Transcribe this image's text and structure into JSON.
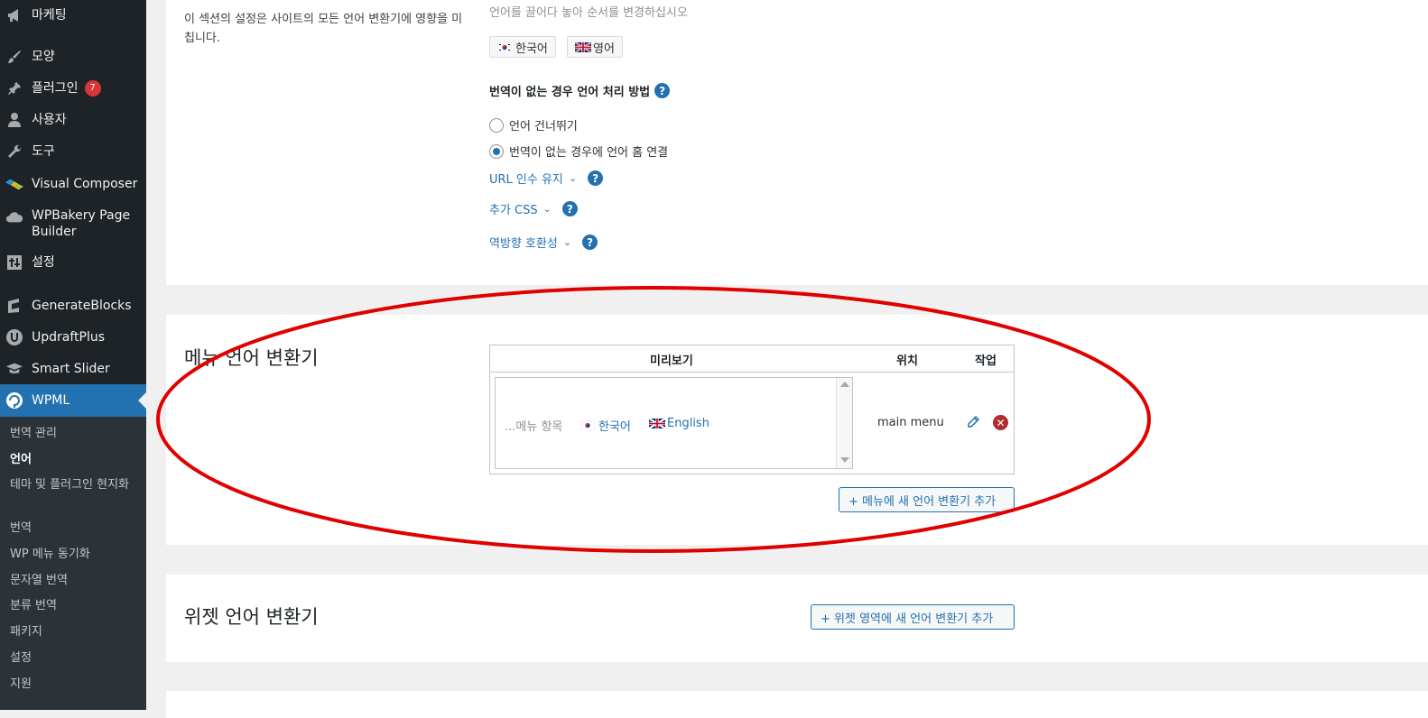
{
  "sidebar": {
    "items": [
      {
        "label": "마케팅",
        "icon": "megaphone-icon"
      },
      {
        "label": "모양",
        "icon": "paintbrush-icon"
      },
      {
        "label": "플러그인",
        "icon": "plugin-icon",
        "badge": "7"
      },
      {
        "label": "사용자",
        "icon": "user-icon"
      },
      {
        "label": "도구",
        "icon": "wrench-icon"
      },
      {
        "label": "Visual Composer",
        "icon": "visual-composer-icon"
      },
      {
        "label": "WPBakery Page Builder",
        "icon": "cloud-icon"
      },
      {
        "label": "설정",
        "icon": "settings-sliders-icon"
      },
      {
        "label": "GenerateBlocks",
        "icon": "generateblocks-icon"
      },
      {
        "label": "UpdraftPlus",
        "icon": "updraftplus-icon"
      },
      {
        "label": "Smart Slider",
        "icon": "graduation-cap-icon"
      },
      {
        "label": "WPML",
        "icon": "wpml-icon"
      }
    ],
    "submenu": [
      {
        "label": "번역 관리"
      },
      {
        "label": "언어",
        "current": true
      },
      {
        "label": "테마 및 플러그인 현지화"
      },
      {
        "label": "번역"
      },
      {
        "label": "WP 메뉴 동기화"
      },
      {
        "label": "문자열 번역"
      },
      {
        "label": "분류 번역"
      },
      {
        "label": "패키지"
      },
      {
        "label": "설정"
      },
      {
        "label": "지원"
      }
    ]
  },
  "options_panel": {
    "description": "이 섹션의 설정은 사이트의 모든 언어 변환기에 영향을 미칩니다.",
    "order_hint": "언어를 끌어다 놓아 순서를 변경하십시오",
    "languages": [
      {
        "label": "한국어",
        "flag": "kr-flag"
      },
      {
        "label": "영어",
        "flag": "gb-flag"
      }
    ],
    "missing_translation_label": "번역이 없는 경우 언어 처리 방법",
    "radio_options": [
      {
        "label": "언어 건너뛰기",
        "checked": false
      },
      {
        "label": "번역이 없는 경우에 언어 홈 연결",
        "checked": true
      }
    ],
    "toggles": [
      "URL 인수 유지",
      "추가 CSS",
      "역방향 호환성"
    ]
  },
  "menu_switcher": {
    "title": "메뉴 언어 변환기",
    "col_preview": "미리보기",
    "col_location": "위치",
    "col_action": "작업",
    "preview_prefix": "...메뉴 항목",
    "preview_lang1": "한국어",
    "preview_lang2": "English",
    "location": "main menu",
    "add_button": "+ 메뉴에 새 언어 변환기 추가"
  },
  "widget_switcher": {
    "title": "위젯 언어 변환기",
    "add_button": "+ 위젯 영역에 새 언어 변환기 추가"
  },
  "colors": {
    "sidebar_bg": "#1d2327",
    "active": "#2271b1",
    "annotation": "#e00000"
  }
}
